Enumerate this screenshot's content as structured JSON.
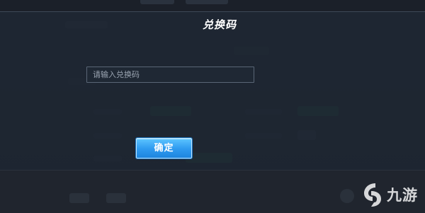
{
  "dialog": {
    "title": "兑换码",
    "code_input": {
      "value": "",
      "placeholder": "请输入兑换码"
    },
    "confirm_label": "确定"
  },
  "watermark": {
    "text": "九游"
  },
  "colors": {
    "dialog_bg": "#1e2632",
    "confirm_button": "#2f9bf0",
    "input_border": "#5a6676"
  }
}
